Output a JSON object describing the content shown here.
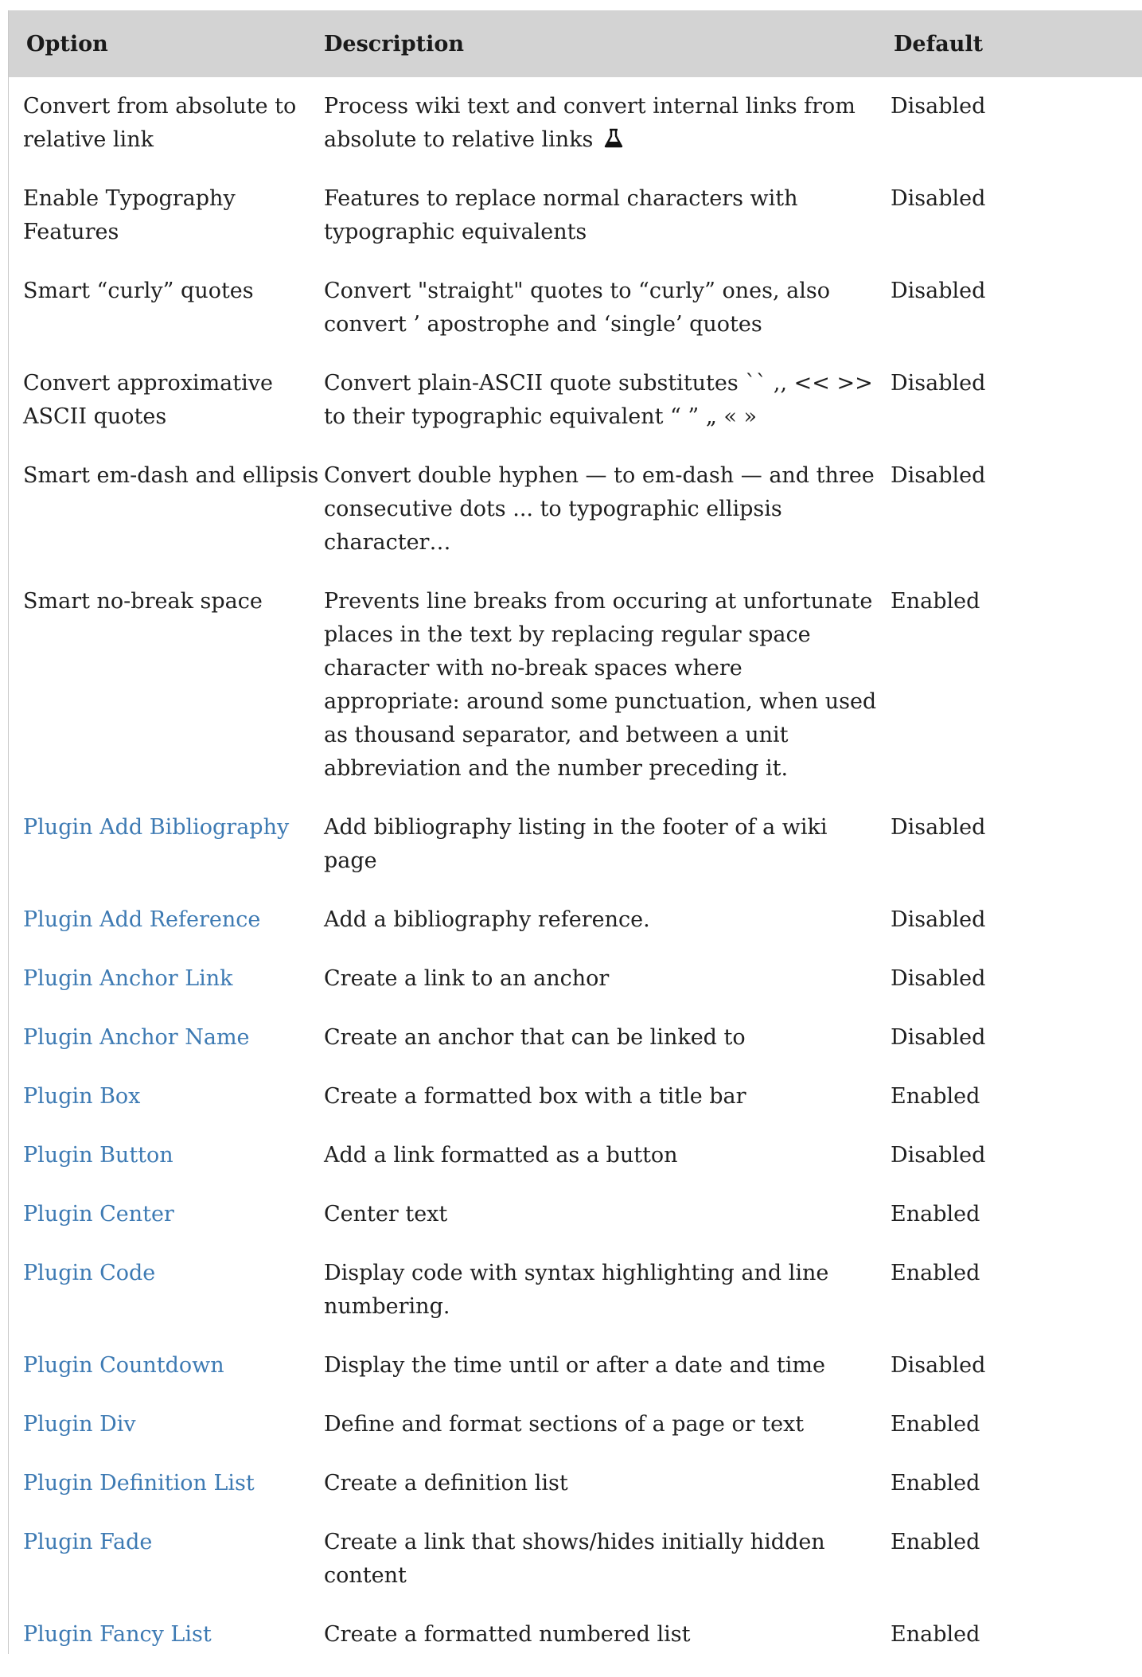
{
  "table": {
    "headers": {
      "option": "Option",
      "description": "Description",
      "default": "Default"
    },
    "rows": [
      {
        "option": "Convert from absolute to relative link",
        "link": false,
        "description": "Process wiki text and convert internal links from absolute to relative links",
        "experimental_icon": "flask-icon",
        "default": "Disabled"
      },
      {
        "option": "Enable Typography Features",
        "link": false,
        "description": "Features to replace normal characters with typographic equivalents",
        "default": "Disabled"
      },
      {
        "option": "Smart “curly” quotes",
        "link": false,
        "description": "Convert \"straight\" quotes to “curly” ones, also convert ’ apostrophe and ‘single’ quotes",
        "default": "Disabled"
      },
      {
        "option": "Convert approximative ASCII quotes",
        "link": false,
        "description": "Convert plain-ASCII quote substitutes `` ,, << >> to their typographic equivalent “ ” „ « »",
        "default": "Disabled"
      },
      {
        "option": "Smart em-dash and ellipsis",
        "link": false,
        "description": "Convert double hyphen — to em-dash — and three consecutive dots ... to typographic ellipsis character…",
        "default": "Disabled"
      },
      {
        "option": "Smart no-break space",
        "link": false,
        "description": "Prevents line breaks from occuring at unfortunate places in the text by replacing regular space character with no-break spaces where appropriate: around some punctuation, when used as thousand separator, and between a unit abbreviation and the number preceding it.",
        "default": "Enabled"
      },
      {
        "option": "Plugin Add Bibliography",
        "link": true,
        "description": "Add bibliography listing in the footer of a wiki page",
        "default": "Disabled"
      },
      {
        "option": "Plugin Add Reference",
        "link": true,
        "description": "Add a bibliography reference.",
        "default": "Disabled"
      },
      {
        "option": "Plugin Anchor Link",
        "link": true,
        "description": "Create a link to an anchor",
        "default": "Disabled"
      },
      {
        "option": "Plugin Anchor Name",
        "link": true,
        "description": "Create an anchor that can be linked to",
        "default": "Disabled"
      },
      {
        "option": "Plugin Box",
        "link": true,
        "description": "Create a formatted box with a title bar",
        "default": "Enabled"
      },
      {
        "option": "Plugin Button",
        "link": true,
        "description": "Add a link formatted as a button",
        "default": "Disabled"
      },
      {
        "option": "Plugin Center",
        "link": true,
        "description": "Center text",
        "default": "Enabled"
      },
      {
        "option": "Plugin Code",
        "link": true,
        "description": "Display code with syntax highlighting and line numbering.",
        "default": "Enabled"
      },
      {
        "option": "Plugin Countdown",
        "link": true,
        "description": "Display the time until or after a date and time",
        "default": "Disabled"
      },
      {
        "option": "Plugin Div",
        "link": true,
        "description": "Define and format sections of a page or text",
        "default": "Enabled"
      },
      {
        "option": "Plugin Definition List",
        "link": true,
        "description": "Create a definition list",
        "default": "Enabled"
      },
      {
        "option": "Plugin Fade",
        "link": true,
        "description": "Create a link that shows/hides initially hidden content",
        "default": "Enabled"
      },
      {
        "option": "Plugin Fancy List",
        "link": true,
        "description": "Create a formatted numbered list",
        "default": "Enabled"
      }
    ]
  },
  "colors": {
    "header_bg": "#d3d3d3",
    "link": "#3d7ab3",
    "text": "#1f1f1f"
  }
}
